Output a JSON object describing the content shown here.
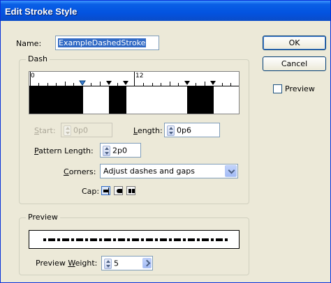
{
  "window": {
    "title": "Edit Stroke Style"
  },
  "name": {
    "label": "Name:",
    "value": "ExampleDashedStroke"
  },
  "buttons": {
    "ok": "OK",
    "cancel": "Cancel"
  },
  "preview_checkbox": {
    "label": "Preview",
    "checked": false
  },
  "dash_group": {
    "title": "Dash",
    "ruler": {
      "start_label": "0",
      "mid_label": "12"
    },
    "start": {
      "label_first": "S",
      "label_rest": "tart:",
      "value": "0p0",
      "enabled": false
    },
    "length": {
      "label_first": "L",
      "label_rest": "ength:",
      "value": "0p6"
    },
    "pattern_length": {
      "label_first": "P",
      "label_rest": "attern Length:",
      "value": "2p0"
    },
    "corners": {
      "label_first": "C",
      "label_rest": "orners:",
      "value": "Adjust dashes and gaps"
    },
    "cap": {
      "label": "Cap:",
      "options": [
        "butt-cap-icon",
        "round-cap-icon",
        "projecting-cap-icon"
      ],
      "selected": 0
    }
  },
  "preview_group": {
    "title": "Preview",
    "weight": {
      "label_before": "Preview ",
      "label_underlined": "W",
      "label_after": "eight:",
      "value": "5"
    }
  },
  "colors": {
    "titlebar": "#0353e0",
    "dialog_bg": "#ece9d8",
    "selection": "#316ac5"
  }
}
